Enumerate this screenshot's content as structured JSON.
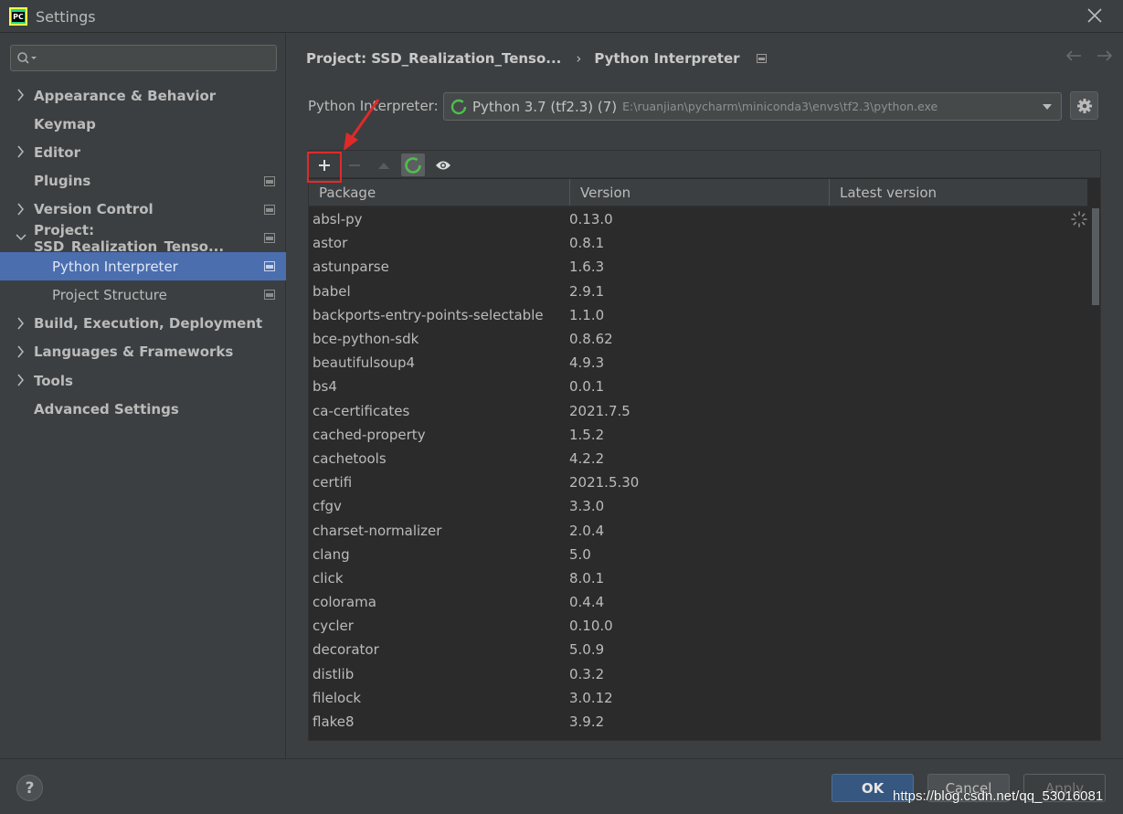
{
  "window": {
    "title": "Settings",
    "logo_text": "PC"
  },
  "sidebar": {
    "search_placeholder": "",
    "items": [
      {
        "label": "Appearance & Behavior",
        "expandable": true,
        "project_icon": false
      },
      {
        "label": "Keymap",
        "expandable": false,
        "project_icon": false
      },
      {
        "label": "Editor",
        "expandable": true,
        "project_icon": false
      },
      {
        "label": "Plugins",
        "expandable": false,
        "project_icon": true
      },
      {
        "label": "Version Control",
        "expandable": true,
        "project_icon": true
      },
      {
        "label": "Project: SSD_Realization_Tenso...",
        "expandable": true,
        "expanded": true,
        "project_icon": true
      },
      {
        "label": "Python Interpreter",
        "sub": true,
        "selected": true,
        "project_icon": true
      },
      {
        "label": "Project Structure",
        "sub": true,
        "project_icon": true
      },
      {
        "label": "Build, Execution, Deployment",
        "expandable": true,
        "project_icon": false
      },
      {
        "label": "Languages & Frameworks",
        "expandable": true,
        "project_icon": false
      },
      {
        "label": "Tools",
        "expandable": true,
        "project_icon": false
      },
      {
        "label": "Advanced Settings",
        "expandable": false,
        "project_icon": false
      }
    ]
  },
  "breadcrumb": {
    "project": "Project: SSD_Realization_Tenso...",
    "separator": "›",
    "page": "Python Interpreter"
  },
  "interpreter": {
    "label": "Python Interpreter:",
    "name": "Python 3.7 (tf2.3) (7)",
    "path": "E:\\ruanjian\\pycharm\\miniconda3\\envs\\tf2.3\\python.exe"
  },
  "table": {
    "columns": [
      "Package",
      "Version",
      "Latest version"
    ],
    "rows": [
      [
        "absl-py",
        "0.13.0"
      ],
      [
        "astor",
        "0.8.1"
      ],
      [
        "astunparse",
        "1.6.3"
      ],
      [
        "babel",
        "2.9.1"
      ],
      [
        "backports-entry-points-selectable",
        "1.1.0"
      ],
      [
        "bce-python-sdk",
        "0.8.62"
      ],
      [
        "beautifulsoup4",
        "4.9.3"
      ],
      [
        "bs4",
        "0.0.1"
      ],
      [
        "ca-certificates",
        "2021.7.5"
      ],
      [
        "cached-property",
        "1.5.2"
      ],
      [
        "cachetools",
        "4.2.2"
      ],
      [
        "certifi",
        "2021.5.30"
      ],
      [
        "cfgv",
        "3.3.0"
      ],
      [
        "charset-normalizer",
        "2.0.4"
      ],
      [
        "clang",
        "5.0"
      ],
      [
        "click",
        "8.0.1"
      ],
      [
        "colorama",
        "0.4.4"
      ],
      [
        "cycler",
        "0.10.0"
      ],
      [
        "decorator",
        "5.0.9"
      ],
      [
        "distlib",
        "0.3.2"
      ],
      [
        "filelock",
        "3.0.12"
      ],
      [
        "flake8",
        "3.9.2"
      ]
    ]
  },
  "footer": {
    "help_label": "?",
    "ok_label": "OK",
    "cancel_label": "Cancel",
    "apply_label": "Apply",
    "watermark": "https://blog.csdn.net/qq_53016081"
  },
  "colors": {
    "selection": "#4b6eaf",
    "highlight_box": "#e02a2a",
    "spinner": "#4ec04e"
  }
}
